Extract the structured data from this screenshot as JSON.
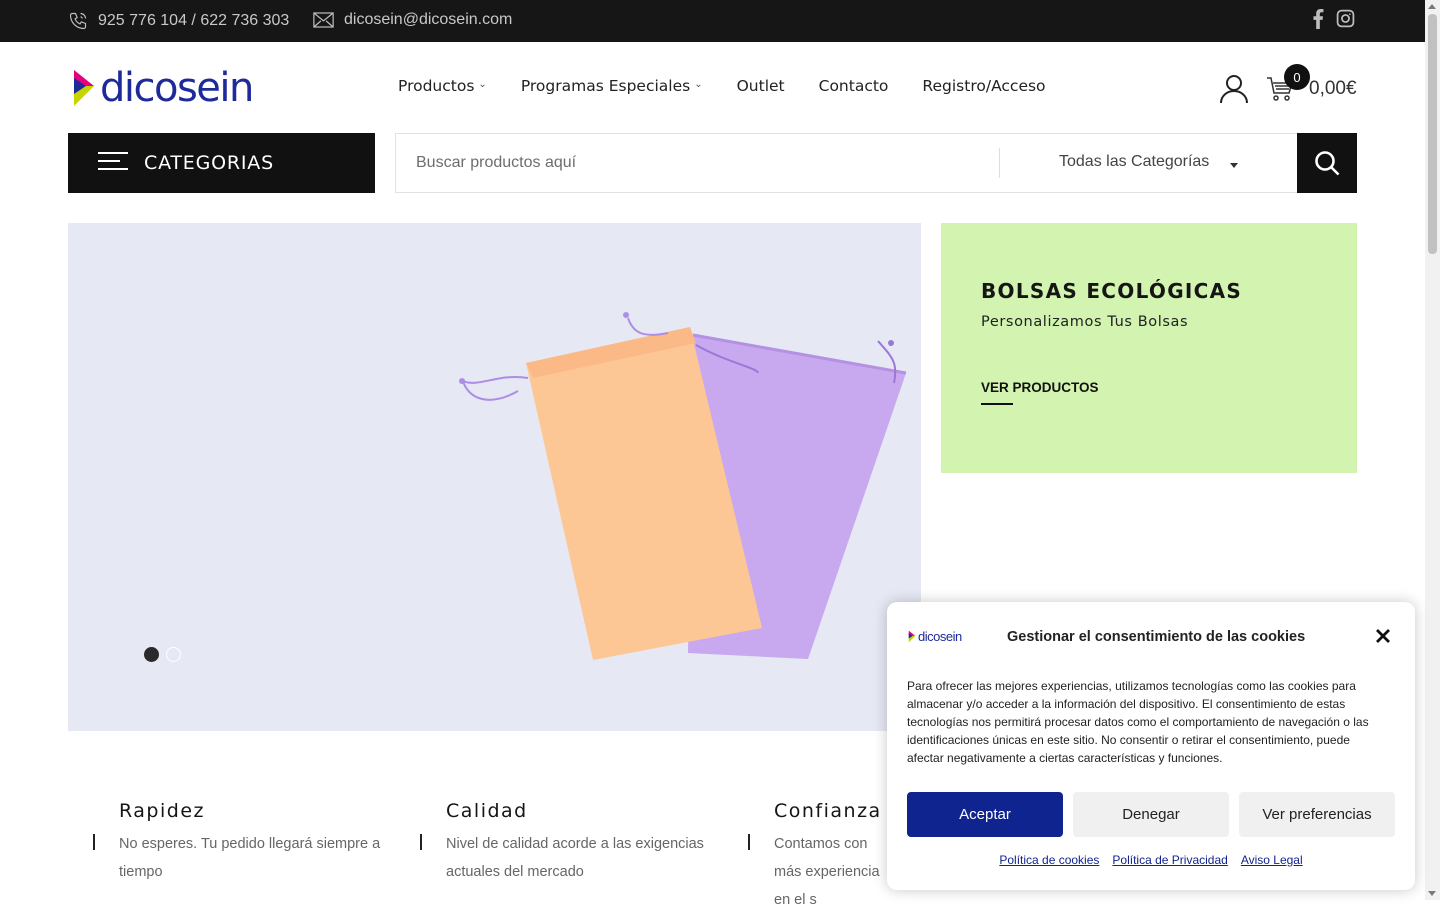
{
  "topbar": {
    "phone": "925 776 104 / 622 736 303",
    "email": "dicosein@dicosein.com",
    "icons": [
      "phone-icon",
      "mail-icon",
      "facebook-icon",
      "instagram-icon"
    ]
  },
  "header": {
    "logo_text": "dicosein",
    "nav": [
      "Productos",
      "Programas Especiales",
      "Outlet",
      "Contacto",
      "Registro/Acceso"
    ],
    "cart_count": "0",
    "cart_total": "0,00€"
  },
  "categories_button": "CATEGORIAS",
  "search": {
    "placeholder": "Buscar productos aquí",
    "category_selected": "Todas las Categorías"
  },
  "slider": {
    "slide_count": 2,
    "active_slide": 1
  },
  "promo": {
    "title": "BOLSAS ECOLÓGICAS",
    "subtitle": "Personalizamos Tus Bolsas",
    "link": "VER PRODUCTOS",
    "background": "#d3f3b0"
  },
  "features": [
    {
      "title": "Rapidez",
      "text": "No esperes. Tu pedido llegará siempre a tiempo"
    },
    {
      "title": "Calidad",
      "text": "Nivel de calidad acorde a las exigencias actuales del mercado"
    },
    {
      "title": "Confianza",
      "text": "Contamos con más experiencia en el s"
    }
  ],
  "cookie": {
    "logo_text": "dicosein",
    "title": "Gestionar el consentimiento de las cookies",
    "body": "Para ofrecer las mejores experiencias, utilizamos tecnologías como las cookies para almacenar y/o acceder a la información del dispositivo. El consentimiento de estas tecnologías nos permitirá procesar datos como el comportamiento de navegación o las identificaciones únicas en este sitio. No consentir o retirar el consentimiento, puede afectar negativamente a ciertas características y funciones.",
    "accept": "Aceptar",
    "deny": "Denegar",
    "preferences": "Ver preferencias",
    "links": [
      "Política de cookies",
      "Política de Privacidad",
      "Aviso Legal"
    ],
    "accent": "#10248f"
  }
}
